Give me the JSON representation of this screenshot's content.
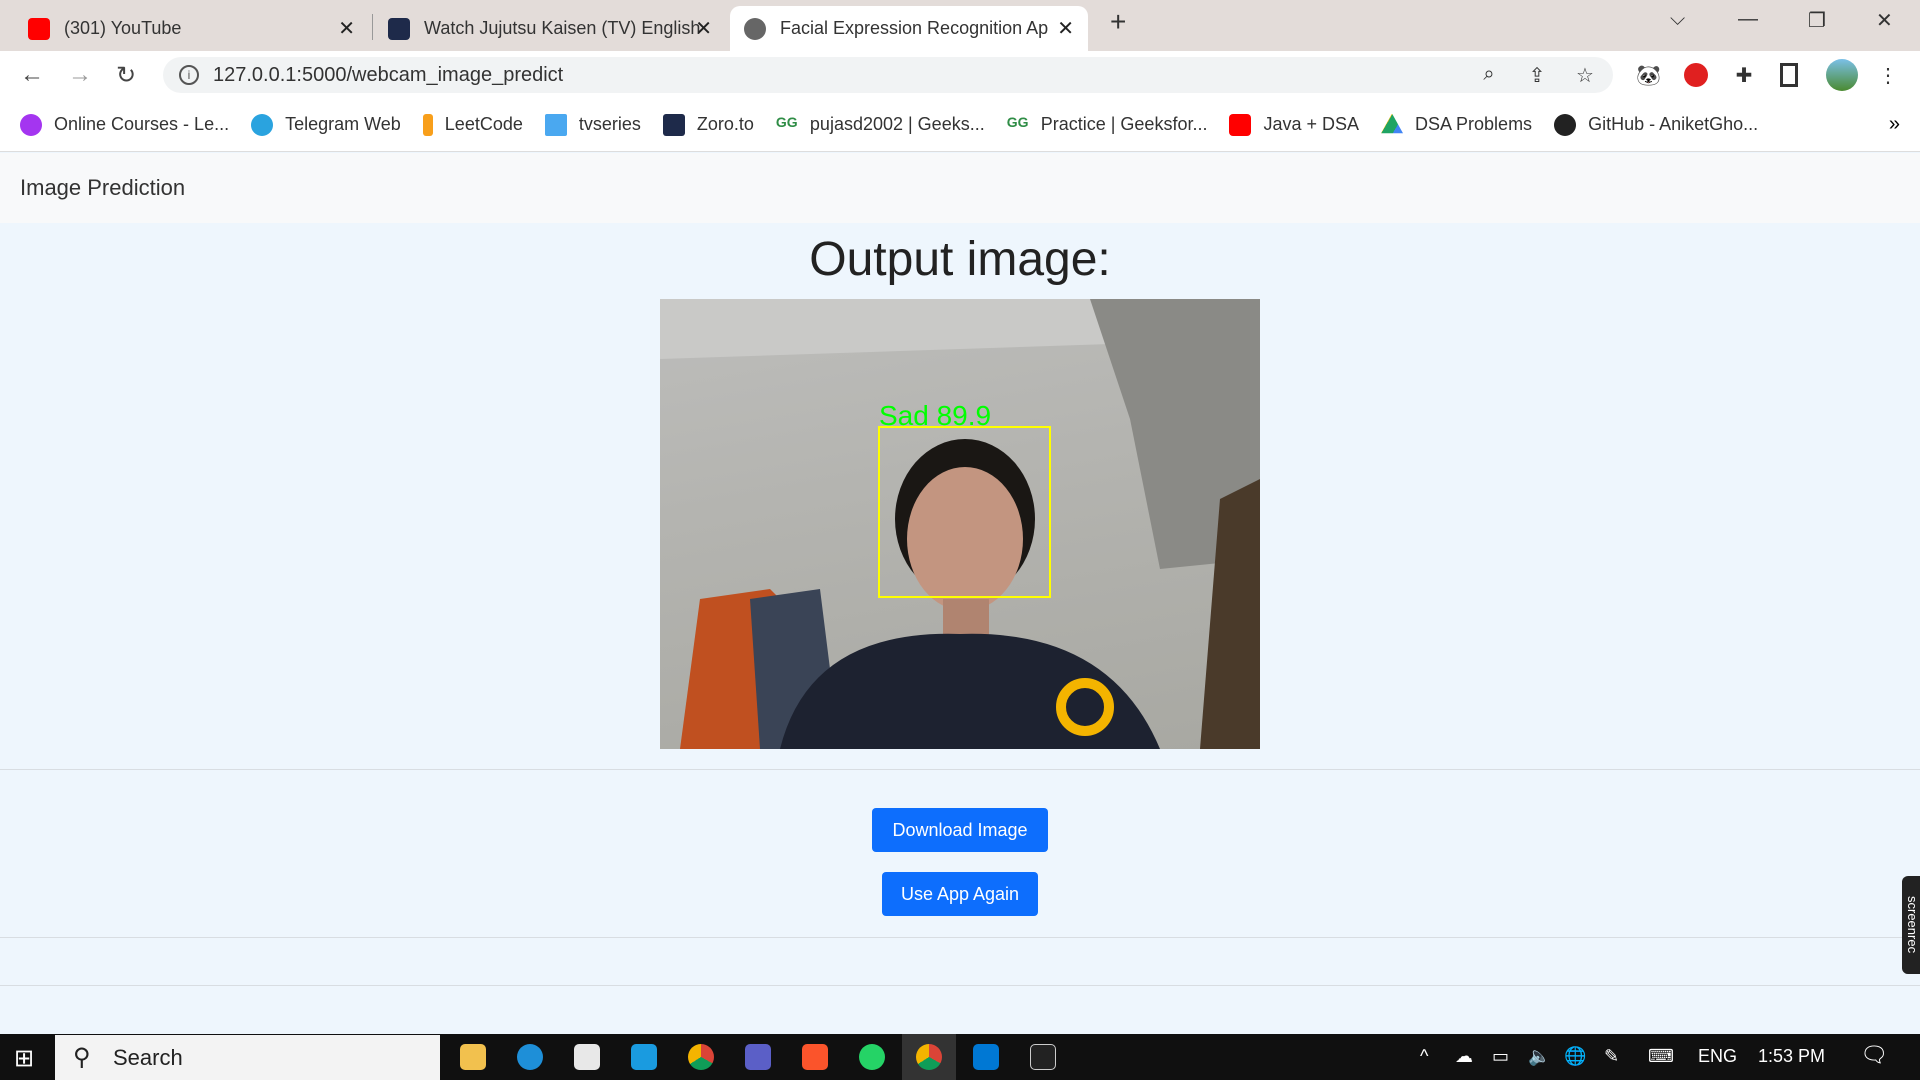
{
  "browser": {
    "tabs": [
      {
        "title": "(301) YouTube",
        "color": "#ff0000"
      },
      {
        "title": "Watch Jujutsu Kaisen (TV) English",
        "color": "#1e2a4a"
      },
      {
        "title": "Facial Expression Recognition Ap",
        "color": "#555555"
      }
    ],
    "url": "127.0.0.1:5000/webcam_image_predict",
    "bookmarks": [
      {
        "label": "Online Courses - Le...",
        "color": "#a435f0"
      },
      {
        "label": "Telegram Web",
        "color": "#2aa3df"
      },
      {
        "label": "LeetCode",
        "color": "#f89f1b"
      },
      {
        "label": "tvseries",
        "color": "#4aa8f0"
      },
      {
        "label": "Zoro.to",
        "color": "#1e2a4a"
      },
      {
        "label": "pujasd2002 | Geeks...",
        "color": "#2f8d46"
      },
      {
        "label": "Practice | Geeksfor...",
        "color": "#2f8d46"
      },
      {
        "label": "Java + DSA",
        "color": "#ff0000"
      },
      {
        "label": "DSA Problems",
        "color": "#1fa463"
      },
      {
        "label": "GitHub - AniketGho...",
        "color": "#222222"
      }
    ],
    "more": "»"
  },
  "page": {
    "brand": "Image Prediction",
    "heading": "Output image:",
    "prediction_label": "Sad 89.9",
    "download_label": "Download Image",
    "again_label": "Use App Again"
  },
  "taskbar": {
    "search": "Search",
    "lang": "ENG",
    "time": "1:53 PM",
    "rec": "screenrec"
  }
}
